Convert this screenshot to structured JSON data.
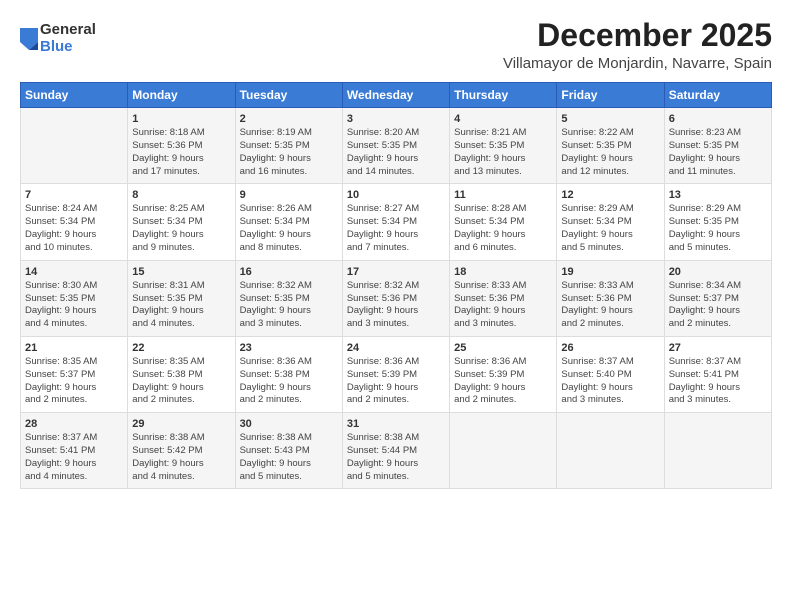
{
  "logo": {
    "general": "General",
    "blue": "Blue"
  },
  "title": "December 2025",
  "location": "Villamayor de Monjardin, Navarre, Spain",
  "weekdays": [
    "Sunday",
    "Monday",
    "Tuesday",
    "Wednesday",
    "Thursday",
    "Friday",
    "Saturday"
  ],
  "weeks": [
    [
      {
        "day": "",
        "info": ""
      },
      {
        "day": "1",
        "info": "Sunrise: 8:18 AM\nSunset: 5:36 PM\nDaylight: 9 hours\nand 17 minutes."
      },
      {
        "day": "2",
        "info": "Sunrise: 8:19 AM\nSunset: 5:35 PM\nDaylight: 9 hours\nand 16 minutes."
      },
      {
        "day": "3",
        "info": "Sunrise: 8:20 AM\nSunset: 5:35 PM\nDaylight: 9 hours\nand 14 minutes."
      },
      {
        "day": "4",
        "info": "Sunrise: 8:21 AM\nSunset: 5:35 PM\nDaylight: 9 hours\nand 13 minutes."
      },
      {
        "day": "5",
        "info": "Sunrise: 8:22 AM\nSunset: 5:35 PM\nDaylight: 9 hours\nand 12 minutes."
      },
      {
        "day": "6",
        "info": "Sunrise: 8:23 AM\nSunset: 5:35 PM\nDaylight: 9 hours\nand 11 minutes."
      }
    ],
    [
      {
        "day": "7",
        "info": "Sunrise: 8:24 AM\nSunset: 5:34 PM\nDaylight: 9 hours\nand 10 minutes."
      },
      {
        "day": "8",
        "info": "Sunrise: 8:25 AM\nSunset: 5:34 PM\nDaylight: 9 hours\nand 9 minutes."
      },
      {
        "day": "9",
        "info": "Sunrise: 8:26 AM\nSunset: 5:34 PM\nDaylight: 9 hours\nand 8 minutes."
      },
      {
        "day": "10",
        "info": "Sunrise: 8:27 AM\nSunset: 5:34 PM\nDaylight: 9 hours\nand 7 minutes."
      },
      {
        "day": "11",
        "info": "Sunrise: 8:28 AM\nSunset: 5:34 PM\nDaylight: 9 hours\nand 6 minutes."
      },
      {
        "day": "12",
        "info": "Sunrise: 8:29 AM\nSunset: 5:34 PM\nDaylight: 9 hours\nand 5 minutes."
      },
      {
        "day": "13",
        "info": "Sunrise: 8:29 AM\nSunset: 5:35 PM\nDaylight: 9 hours\nand 5 minutes."
      }
    ],
    [
      {
        "day": "14",
        "info": "Sunrise: 8:30 AM\nSunset: 5:35 PM\nDaylight: 9 hours\nand 4 minutes."
      },
      {
        "day": "15",
        "info": "Sunrise: 8:31 AM\nSunset: 5:35 PM\nDaylight: 9 hours\nand 4 minutes."
      },
      {
        "day": "16",
        "info": "Sunrise: 8:32 AM\nSunset: 5:35 PM\nDaylight: 9 hours\nand 3 minutes."
      },
      {
        "day": "17",
        "info": "Sunrise: 8:32 AM\nSunset: 5:36 PM\nDaylight: 9 hours\nand 3 minutes."
      },
      {
        "day": "18",
        "info": "Sunrise: 8:33 AM\nSunset: 5:36 PM\nDaylight: 9 hours\nand 3 minutes."
      },
      {
        "day": "19",
        "info": "Sunrise: 8:33 AM\nSunset: 5:36 PM\nDaylight: 9 hours\nand 2 minutes."
      },
      {
        "day": "20",
        "info": "Sunrise: 8:34 AM\nSunset: 5:37 PM\nDaylight: 9 hours\nand 2 minutes."
      }
    ],
    [
      {
        "day": "21",
        "info": "Sunrise: 8:35 AM\nSunset: 5:37 PM\nDaylight: 9 hours\nand 2 minutes."
      },
      {
        "day": "22",
        "info": "Sunrise: 8:35 AM\nSunset: 5:38 PM\nDaylight: 9 hours\nand 2 minutes."
      },
      {
        "day": "23",
        "info": "Sunrise: 8:36 AM\nSunset: 5:38 PM\nDaylight: 9 hours\nand 2 minutes."
      },
      {
        "day": "24",
        "info": "Sunrise: 8:36 AM\nSunset: 5:39 PM\nDaylight: 9 hours\nand 2 minutes."
      },
      {
        "day": "25",
        "info": "Sunrise: 8:36 AM\nSunset: 5:39 PM\nDaylight: 9 hours\nand 2 minutes."
      },
      {
        "day": "26",
        "info": "Sunrise: 8:37 AM\nSunset: 5:40 PM\nDaylight: 9 hours\nand 3 minutes."
      },
      {
        "day": "27",
        "info": "Sunrise: 8:37 AM\nSunset: 5:41 PM\nDaylight: 9 hours\nand 3 minutes."
      }
    ],
    [
      {
        "day": "28",
        "info": "Sunrise: 8:37 AM\nSunset: 5:41 PM\nDaylight: 9 hours\nand 4 minutes."
      },
      {
        "day": "29",
        "info": "Sunrise: 8:38 AM\nSunset: 5:42 PM\nDaylight: 9 hours\nand 4 minutes."
      },
      {
        "day": "30",
        "info": "Sunrise: 8:38 AM\nSunset: 5:43 PM\nDaylight: 9 hours\nand 5 minutes."
      },
      {
        "day": "31",
        "info": "Sunrise: 8:38 AM\nSunset: 5:44 PM\nDaylight: 9 hours\nand 5 minutes."
      },
      {
        "day": "",
        "info": ""
      },
      {
        "day": "",
        "info": ""
      },
      {
        "day": "",
        "info": ""
      }
    ]
  ]
}
